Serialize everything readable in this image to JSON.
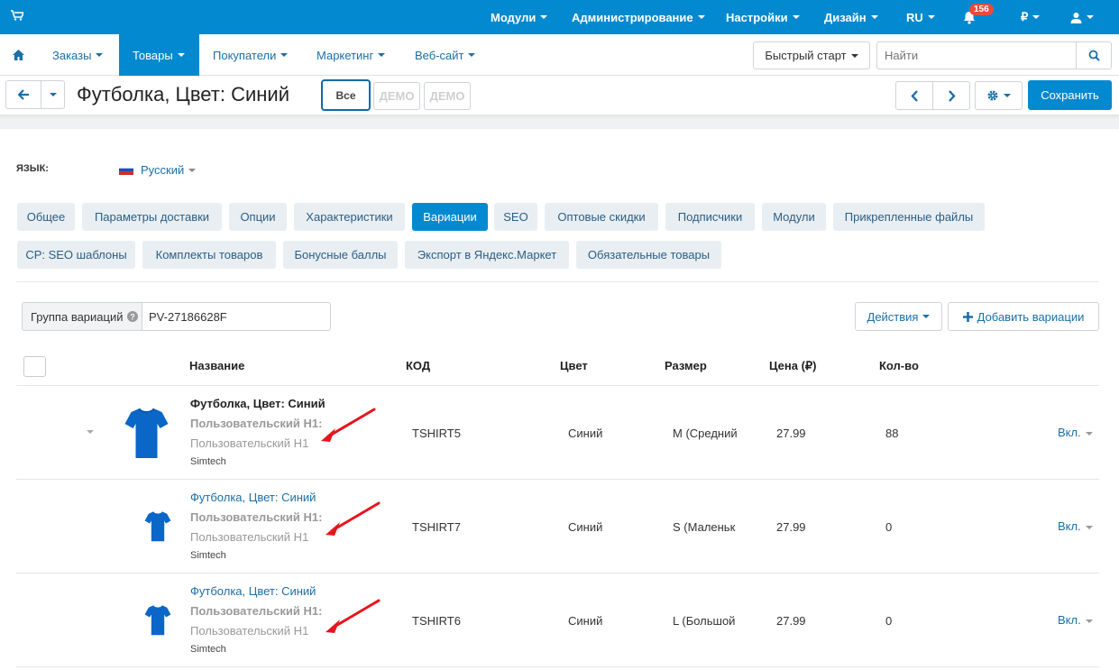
{
  "topbar": {
    "menu": [
      "Модули",
      "Администрирование",
      "Настройки",
      "Дизайн",
      "RU"
    ],
    "notifications": "156",
    "currency": "₽"
  },
  "navbar": {
    "items": [
      "Заказы",
      "Товары",
      "Покупатели",
      "Маркетинг",
      "Веб-сайт"
    ],
    "quick_start": "Быстрый старт",
    "search_placeholder": "Найти"
  },
  "titlebar": {
    "title": "Футболка, Цвет: Синий",
    "all": "Все",
    "demo1": "ДЕМО",
    "demo2": "ДЕМО",
    "save": "Сохранить"
  },
  "language": {
    "label": "ЯЗЫК:",
    "value": "Русский"
  },
  "tabs_row1": [
    "Общее",
    "Параметры доставки",
    "Опции",
    "Характеристики",
    "Вариации",
    "SEO",
    "Оптовые скидки",
    "Подписчики",
    "Модули",
    "Прикрепленные файлы"
  ],
  "tabs_row2": [
    "CP: SEO шаблоны",
    "Комплекты товаров",
    "Бонусные баллы",
    "Экспорт в Яндекс.Маркет",
    "Обязательные товары"
  ],
  "group": {
    "label": "Группа вариаций",
    "value": "PV-27186628F"
  },
  "actions": {
    "actions": "Действия",
    "add": "Добавить вариации"
  },
  "table": {
    "headers": [
      "Название",
      "КОД",
      "Цвет",
      "Размер",
      "Цена (₽)",
      "Кол-во"
    ],
    "rows": [
      {
        "name": "Футболка, Цвет: Синий",
        "h1_label": "Пользовательский H1:",
        "h1_value": "Пользовательский H1",
        "vendor": "Simtech",
        "code": "TSHIRT5",
        "color": "Синий",
        "size": "M (Средний",
        "price": "27.99",
        "qty": "88",
        "status": "Вкл."
      },
      {
        "name": "Футболка, Цвет: Синий",
        "h1_label": "Пользовательский H1:",
        "h1_value": "Пользовательский H1",
        "vendor": "Simtech",
        "code": "TSHIRT7",
        "color": "Синий",
        "size": "S (Маленьк",
        "price": "27.99",
        "qty": "0",
        "status": "Вкл."
      },
      {
        "name": "Футболка, Цвет: Синий",
        "h1_label": "Пользовательский H1:",
        "h1_value": "Пользовательский H1",
        "vendor": "Simtech",
        "code": "TSHIRT6",
        "color": "Синий",
        "size": "L (Большой",
        "price": "27.99",
        "qty": "0",
        "status": "Вкл."
      }
    ]
  },
  "colors": {
    "primary": "#0389cf",
    "link": "#1a6fa8",
    "arrow": "#e8141c"
  }
}
